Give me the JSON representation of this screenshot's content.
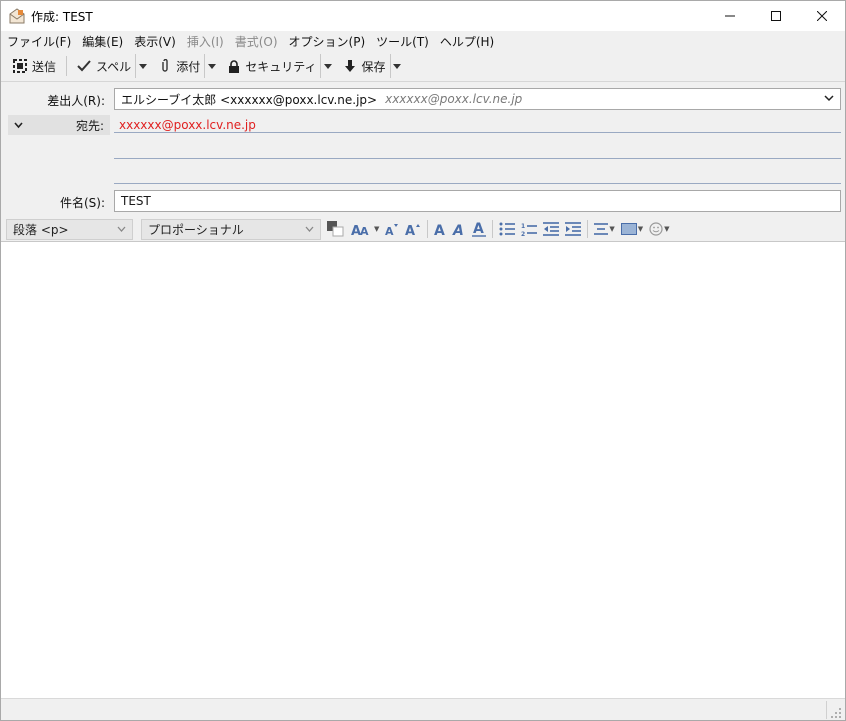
{
  "window": {
    "title": "作成: TEST",
    "minimize_icon": "minimize-icon",
    "maximize_icon": "maximize-icon",
    "close_icon": "close-icon"
  },
  "menu": [
    {
      "label": "ファイル(F)",
      "enabled": true
    },
    {
      "label": "編集(E)",
      "enabled": true
    },
    {
      "label": "表示(V)",
      "enabled": true
    },
    {
      "label": "挿入(I)",
      "enabled": false
    },
    {
      "label": "書式(O)",
      "enabled": false
    },
    {
      "label": "オプション(P)",
      "enabled": true
    },
    {
      "label": "ツール(T)",
      "enabled": true
    },
    {
      "label": "ヘルプ(H)",
      "enabled": true
    }
  ],
  "toolbar": {
    "send_label": "送信",
    "spell_label": "スペル",
    "attach_label": "添付",
    "security_label": "セキュリティ",
    "save_label": "保存"
  },
  "headers": {
    "from_label": "差出人(R):",
    "from_value": "エルシーブイ太郎 <xxxxxx@poxx.lcv.ne.jp>",
    "from_hint": "xxxxxx@poxx.lcv.ne.jp",
    "to_label": "宛先:",
    "to_value": "xxxxxx@poxx.lcv.ne.jp",
    "subject_label": "件名(S):",
    "subject_value": "TEST"
  },
  "format": {
    "paragraph": "段落 <p>",
    "font": "プロポーショナル"
  },
  "colors": {
    "to_address": "#e02020",
    "accent_icon": "#4a6ea9"
  }
}
